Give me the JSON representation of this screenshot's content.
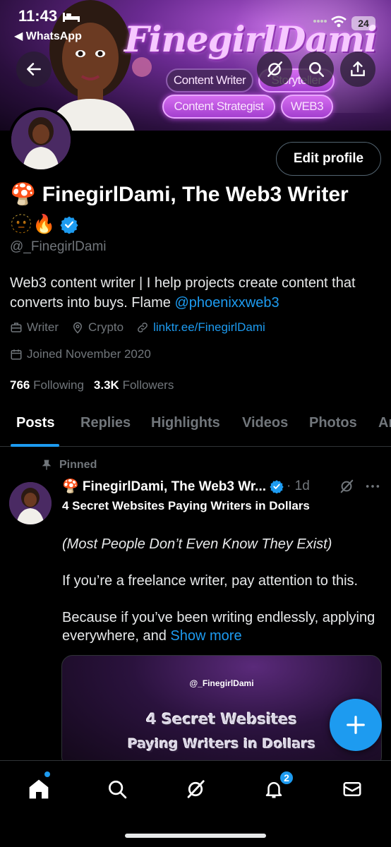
{
  "status_bar": {
    "time": "11:43",
    "back_app": "◀ WhatsApp",
    "battery": "24"
  },
  "banner": {
    "title": "FinegirlDami",
    "pills": [
      "Content Writer",
      "Storyteller",
      "Content Strategist",
      "WEB3"
    ]
  },
  "profile": {
    "edit_label": "Edit profile",
    "display_name": "FinegirlDami, The Web3 Writer",
    "name_emoji_lead": "🍄",
    "name_emoji_tail": "🫥🔥",
    "handle": "@_FinegirlDami",
    "bio_text": "Web3 content writer | I help projects create content that converts into buys. Flame ",
    "bio_mention": "@phoenixxweb3",
    "category": "Writer",
    "location": "Crypto",
    "website": "linktr.ee/FinegirlDami",
    "joined": "Joined November 2020",
    "following_count": "766",
    "following_label": "Following",
    "followers_count": "3.3K",
    "followers_label": "Followers"
  },
  "tabs": [
    "Posts",
    "Replies",
    "Highlights",
    "Videos",
    "Photos",
    "Ar"
  ],
  "post": {
    "pinned_label": "Pinned",
    "author": "🍄 FinegirlDami, The Web3 Wr...",
    "date": "· 1d",
    "title": "4 Secret Websites Paying Writers in Dollars",
    "line1": "(Most People Don’t Even Know They Exist)",
    "line2": "If you’re a freelance writer, pay attention to this.",
    "line3": "Because if you’ve been writing endlessly, applying everywhere, and ",
    "show_more": "Show more",
    "card_handle": "@_FinegirlDami",
    "card_title1": "4 Secret Websites",
    "card_title2": "Paying Writers in Dollars"
  },
  "nav": {
    "notifications_badge": "2"
  },
  "colors": {
    "accent": "#1d9bf0",
    "background": "#000000",
    "muted": "#71767b"
  }
}
